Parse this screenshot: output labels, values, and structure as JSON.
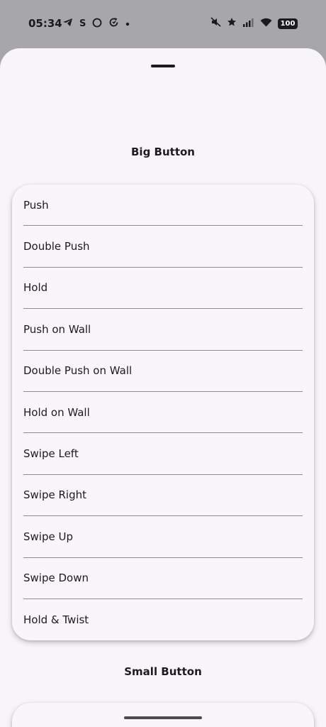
{
  "status_bar": {
    "time": "05:34",
    "left_icons": [
      "telegram-icon",
      "s-app-icon",
      "circle-icon",
      "sync-icon",
      "dot-icon"
    ],
    "right_icons": [
      "mute-icon",
      "star-icon",
      "signal-icon",
      "wifi-icon"
    ],
    "battery": "100"
  },
  "sheet": {
    "big_button": {
      "title": "Big Button",
      "items": [
        "Push",
        "Double Push",
        "Hold",
        "Push on Wall",
        "Double Push on Wall",
        "Hold on Wall",
        "Swipe Left",
        "Swipe Right",
        "Swipe Up",
        "Swipe Down",
        "Hold & Twist"
      ]
    },
    "small_button": {
      "title": "Small Button"
    }
  }
}
